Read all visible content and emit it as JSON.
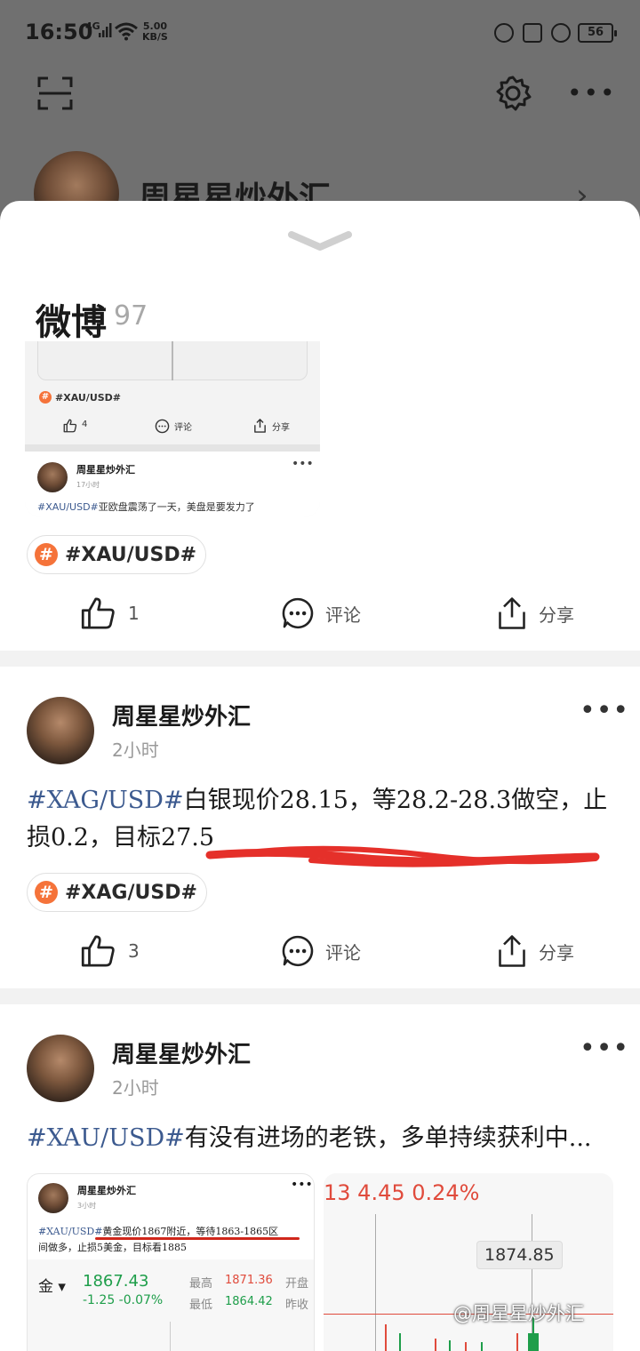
{
  "status_bar": {
    "time": "16:50",
    "network": "4G",
    "speed_value": "5.00",
    "speed_unit": "KB/S",
    "battery": "56"
  },
  "profile": {
    "name": "周星星炒外汇"
  },
  "section": {
    "title": "微博",
    "count": "97"
  },
  "embedded_top": {
    "tag": "#XAU/USD#",
    "like_count": "4",
    "comment_label": "评论",
    "share_label": "分享",
    "author": "周星星炒外汇",
    "time": "17小时",
    "text_topic": "#XAU/USD#",
    "text_body": "亚欧盘震荡了一天，美盘是要发力了"
  },
  "post0": {
    "topic_chip": "#XAU/USD#",
    "like_count": "1",
    "comment_label": "评论",
    "share_label": "分享"
  },
  "post1": {
    "author": "周星星炒外汇",
    "time": "2小时",
    "topic": "#XAG/USD#",
    "body": "白银现价28.15，等28.2-28.3做空，止损0.2，目标27.5",
    "topic_chip": "#XAG/USD#",
    "like_count": "3",
    "comment_label": "评论",
    "share_label": "分享"
  },
  "post2": {
    "author": "周星星炒外汇",
    "time": "2小时",
    "topic": "#XAU/USD#",
    "body": "有没有进场的老铁，多单持续获利中...",
    "image_a": {
      "author": "周星星炒外汇",
      "time": "3小时",
      "topic": "#XAU/USD#",
      "line1": "黄金现价1867附近，等待1863-1865区",
      "line2": "间做多，止损5美金，目标看1885",
      "asset": "金 ▾",
      "price": "1867.43",
      "change": "-1.25   -0.07%",
      "high_label": "最高",
      "high_value": "1871.36",
      "low_label": "最低",
      "low_value": "1864.42",
      "open_label": "开盘",
      "prev_label": "昨收"
    },
    "image_b": {
      "header": "13  4.45  0.24%",
      "price_label": "1874.85"
    }
  },
  "watermark": "@周星星炒外汇",
  "colors": {
    "topic": "#3c5a8f",
    "hash_badge": "#f5733a",
    "up_green": "#1e9e4a",
    "down_red": "#e04b3c"
  }
}
